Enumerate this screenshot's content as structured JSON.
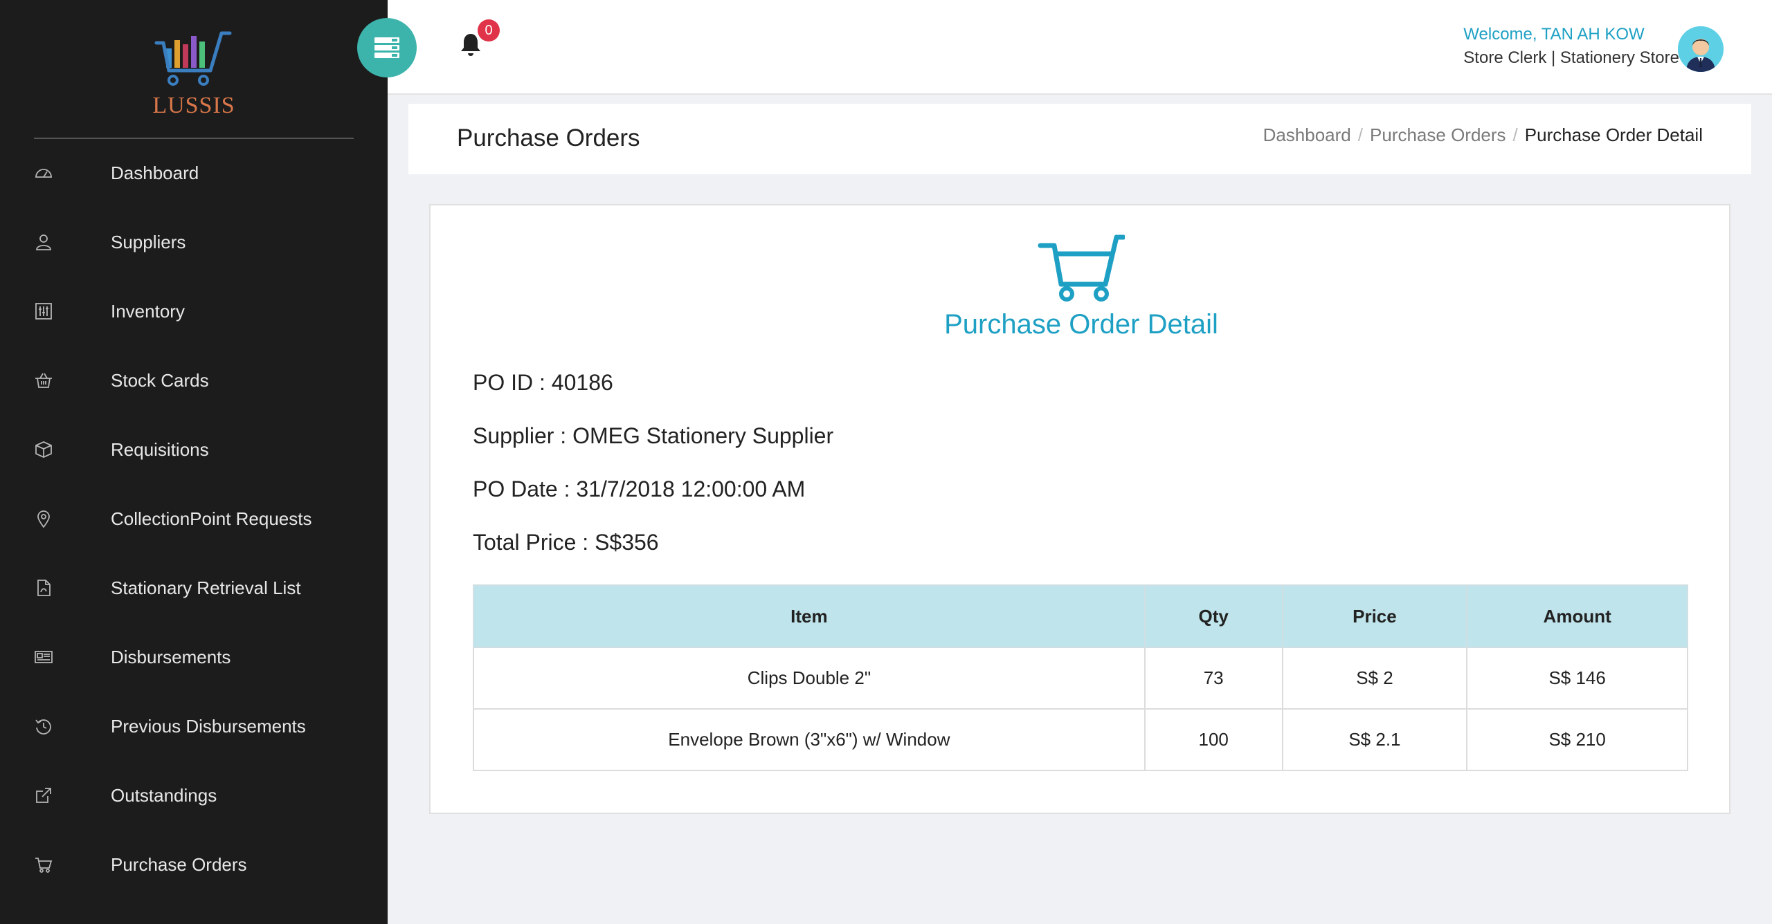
{
  "logo": {
    "text": "LUSSIS"
  },
  "sidebar": {
    "items": [
      {
        "label": "Dashboard",
        "icon": "dashboard-gauge-icon"
      },
      {
        "label": "Suppliers",
        "icon": "user-icon"
      },
      {
        "label": "Inventory",
        "icon": "sliders-icon"
      },
      {
        "label": "Stock Cards",
        "icon": "basket-icon"
      },
      {
        "label": "Requisitions",
        "icon": "box-icon"
      },
      {
        "label": "CollectionPoint Requests",
        "icon": "map-pin-icon"
      },
      {
        "label": "Stationary Retrieval List",
        "icon": "pdf-file-icon"
      },
      {
        "label": "Disbursements",
        "icon": "newspaper-icon"
      },
      {
        "label": "Previous Disbursements",
        "icon": "history-icon"
      },
      {
        "label": "Outstandings",
        "icon": "external-link-icon"
      },
      {
        "label": "Purchase Orders",
        "icon": "cart-icon"
      }
    ]
  },
  "header": {
    "notification_count": "0",
    "welcome": "Welcome, TAN AH KOW",
    "role": "Store Clerk | Stationery Store"
  },
  "page": {
    "title": "Purchase Orders",
    "breadcrumb": [
      "Dashboard",
      "Purchase Orders",
      "Purchase Order Detail"
    ]
  },
  "detail": {
    "title": "Purchase Order Detail",
    "po_id": "PO ID : 40186",
    "supplier": "Supplier : OMEG Stationery Supplier",
    "po_date": "PO Date : 31/7/2018 12:00:00 AM",
    "total_price": "Total Price : S$356"
  },
  "table": {
    "headers": [
      "Item",
      "Qty",
      "Price",
      "Amount"
    ],
    "rows": [
      [
        "Clips Double 2\"",
        "73",
        "S$ 2",
        "S$ 146"
      ],
      [
        "Envelope Brown (3\"x6\") w/ Window",
        "100",
        "S$ 2.1",
        "S$ 210"
      ]
    ]
  },
  "colors": {
    "sidebar_bg": "#1c1c1c",
    "accent_teal": "#3cb3ab",
    "accent_blue": "#1ea0c4",
    "table_header": "#bfe4eb",
    "badge_red": "#e0334a"
  }
}
